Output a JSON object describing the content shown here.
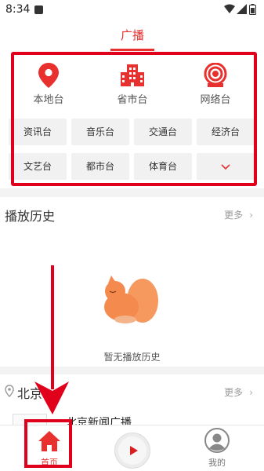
{
  "status": {
    "time": "8:34"
  },
  "header": {
    "tab_label": "广播"
  },
  "categories": [
    {
      "label": "本地台",
      "icon": "location-pin-icon"
    },
    {
      "label": "省市台",
      "icon": "building-icon"
    },
    {
      "label": "网络台",
      "icon": "broadcast-icon"
    }
  ],
  "tags": [
    "资讯台",
    "音乐台",
    "交通台",
    "经济台",
    "文艺台",
    "都市台",
    "体育台"
  ],
  "history": {
    "title": "播放历史",
    "more": "更多",
    "empty_text": "暂无播放历史"
  },
  "beijing": {
    "title": "北京",
    "more": "更多",
    "station_name": "北京新闻广播"
  },
  "nav": {
    "home_label": "首页",
    "mine_label": "我的"
  },
  "colors": {
    "accent": "#e8302e",
    "highlight": "#e0001b"
  }
}
